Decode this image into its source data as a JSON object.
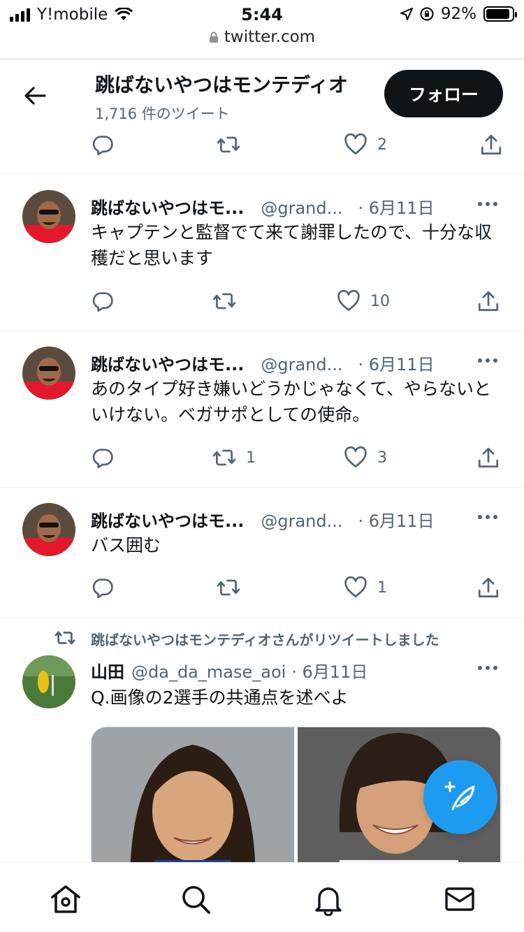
{
  "status_bar": {
    "carrier": "Y!mobile",
    "time": "5:44",
    "battery": "92%",
    "battery_level": 0.92
  },
  "browser": {
    "url": "twitter.com"
  },
  "profile_header": {
    "name": "跳ばないやつはモンテディオ",
    "tweet_count": "1,716 件のツイート",
    "follow_label": "フォロー"
  },
  "top_actions": {
    "reply": "",
    "retweet": "",
    "like": "2"
  },
  "tweets": [
    {
      "name": "跳ばないやつはモ...",
      "handle": "@grand...",
      "date": "· 6月11日",
      "text": "キャプテンと監督でて来て謝罪したので、十分な収穫だと思います",
      "reply": "",
      "retweet": "",
      "like": "10"
    },
    {
      "name": "跳ばないやつはモ...",
      "handle": "@grand...",
      "date": "· 6月11日",
      "text": "あのタイプ好き嫌いどうかじゃなくて、やらないといけない。ベガサポとしての使命。",
      "reply": "",
      "retweet": "1",
      "like": "3"
    },
    {
      "name": "跳ばないやつはモ...",
      "handle": "@grand...",
      "date": "· 6月11日",
      "text": "バス囲む",
      "reply": "",
      "retweet": "",
      "like": "1"
    }
  ],
  "retweeted": {
    "label": "跳ばないやつはモンテディオさんがリツイートしました",
    "name": "山田",
    "handle": "@da_da_mase_aoi",
    "date": "· 6月11日",
    "text": "Q.画像の2選手の共通点を述べよ"
  },
  "icons": {
    "back": "arrow-left-icon",
    "reply": "reply-icon",
    "retweet": "retweet-icon",
    "like": "heart-icon",
    "share": "share-icon",
    "more": "more-icon",
    "compose": "compose-tweet-icon",
    "home": "home-icon",
    "search": "search-icon",
    "notifications": "bell-icon",
    "messages": "mail-icon"
  },
  "colors": {
    "accent": "#1d9bf0",
    "text": "#0f1419",
    "secondary": "#536471",
    "follow_bg": "#0f1419"
  }
}
